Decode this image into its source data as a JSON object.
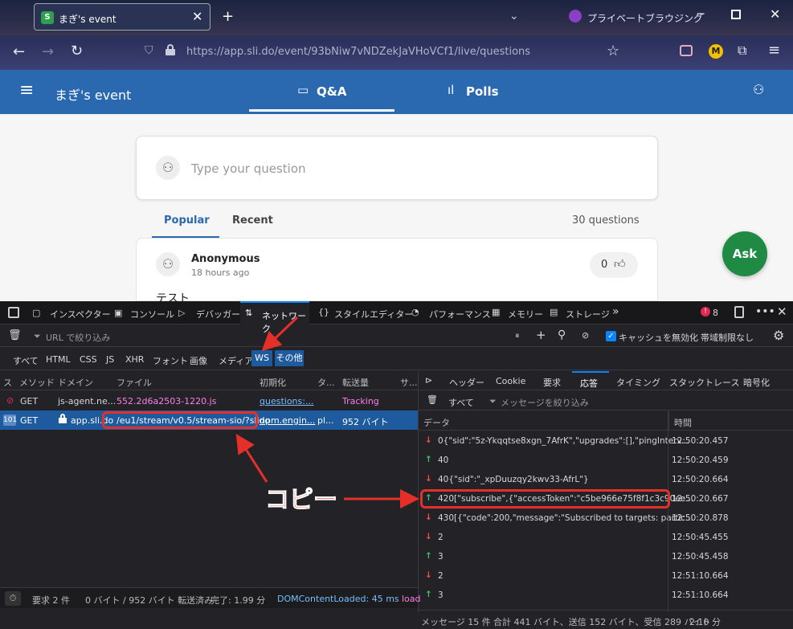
{
  "browser": {
    "tab_title": "まぎ's event",
    "tab_icon_letter": "S",
    "private_label": "プライベートブラウジング",
    "url": "https://app.sli.do/event/93bNiw7vNDZekJaVHoVCf1/live/questions",
    "extension_letter": "M"
  },
  "slido": {
    "event_title": "まぎ's event",
    "tabs": [
      "Q&A",
      "Polls"
    ],
    "question_placeholder": "Type your question",
    "list_tabs": [
      "Popular",
      "Recent"
    ],
    "question_count": "30 questions",
    "question": {
      "author": "Anonymous",
      "time": "18 hours ago",
      "likes": "0",
      "text": "テスト"
    },
    "ask_button": "Ask"
  },
  "devtools": {
    "tools": [
      "インスペクター",
      "コンソール",
      "デバッガー",
      "ネットワーク",
      "スタイルエディター",
      "パフォーマンス",
      "メモリー",
      "ストレージ"
    ],
    "error_count": "8",
    "filter_placeholder": "URL で絞り込み",
    "disable_cache": "キャッシュを無効化",
    "throttle": "帯域制限なし",
    "type_filters": [
      "すべて",
      "HTML",
      "CSS",
      "JS",
      "XHR",
      "フォント",
      "画像",
      "メディア",
      "WS",
      "その他"
    ],
    "columns": [
      "ス",
      "メソッド",
      "ドメイン",
      "ファイル",
      "初期化",
      "タ...",
      "転送量",
      "サ..."
    ],
    "requests": [
      {
        "status": "",
        "method": "GET",
        "domain": "js-agent.ne...",
        "file": "552.2d6a2503-1220.js",
        "init": "questions:...",
        "type": "",
        "transfer": "Tracking"
      },
      {
        "status": "101",
        "method": "GET",
        "domain": "app.sli.do",
        "file": "/eu1/stream/v0.5/stream-sio/?slido",
        "init": "npm.engin...",
        "type": "pl...",
        "transfer": "952 バイト"
      }
    ],
    "detail_tabs": [
      "ヘッダー",
      "Cookie",
      "要求",
      "応答",
      "タイミング",
      "スタックトレース",
      "暗号化"
    ],
    "msg_filter_all": "すべて",
    "msg_filter_placeholder": "メッセージを絞り込み",
    "msg_columns": [
      "データ",
      "時間"
    ],
    "messages": [
      {
        "dir": "down",
        "data": "0{\"sid\":\"5z-Ykqqtse8xgn_7AfrK\",\"upgrades\":[],\"pingInterv...",
        "time": "12:50:20.457"
      },
      {
        "dir": "up",
        "data": "40",
        "time": "12:50:20.459"
      },
      {
        "dir": "down",
        "data": "40{\"sid\":\"_xpDuuzqy2kwv33-AfrL\"}",
        "time": "12:50:20.664"
      },
      {
        "dir": "up",
        "data": "420[\"subscribe\",{\"accessToken\":\"c5be966e75f8f1c3c90ee...",
        "time": "12:50:20.667"
      },
      {
        "dir": "down",
        "data": "430[{\"code\":200,\"message\":\"Subscribed to targets: partic...",
        "time": "12:50:20.878"
      },
      {
        "dir": "down",
        "data": "2",
        "time": "12:50:45.455"
      },
      {
        "dir": "up",
        "data": "3",
        "time": "12:50:45.458"
      },
      {
        "dir": "down",
        "data": "2",
        "time": "12:51:10.664"
      },
      {
        "dir": "up",
        "data": "3",
        "time": "12:51:10.664"
      }
    ],
    "status_bar": {
      "requests": "要求 2 件",
      "transfer": "0 バイト / 952 バイト 転送済み",
      "finish": "完了: 1.99 分",
      "dom": "DOMContentLoaded: 45 ms",
      "load": "load"
    },
    "msg_status": {
      "count": "メッセージ 15 件",
      "totals": "合計 441 バイト、送信 152 バイト、受信 289 バイト",
      "duration": "2.10 分"
    }
  },
  "annotation": {
    "copy_label": "コピー"
  },
  "colors": {
    "slido_blue": "#2a68b0",
    "ask_green": "#1f8a44",
    "annotation_red": "#e5302a",
    "devtools_bg": "#232327",
    "selected_row": "#1e5a9e"
  }
}
